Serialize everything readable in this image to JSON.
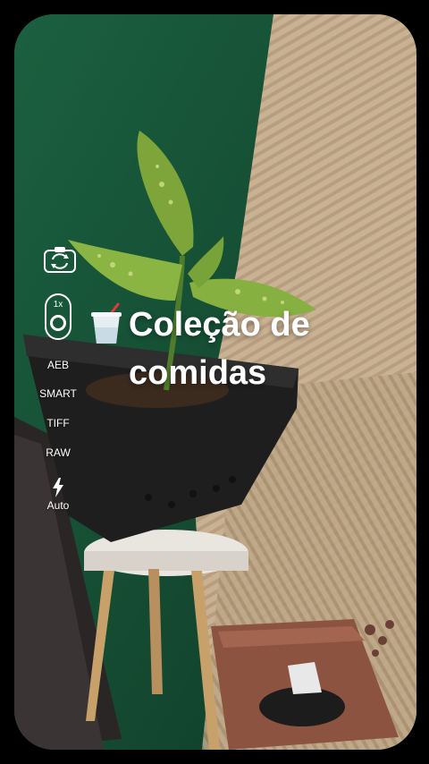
{
  "controls": {
    "zoom": "1x",
    "aeb": "AEB",
    "smart": "SMART",
    "tiff": "TIFF",
    "raw": "RAW",
    "flash": "Auto"
  },
  "overlay": {
    "line1": "Coleção de",
    "line2": "comidas"
  },
  "colors": {
    "wall_green": "#1d5a3d",
    "panel_wood": "#c8b192",
    "pot_black": "#222222",
    "pot_terracotta": "#8c5341"
  },
  "icons": [
    "camera-switch-icon",
    "lens-icon",
    "flash-icon",
    "cup-emoji-icon"
  ]
}
